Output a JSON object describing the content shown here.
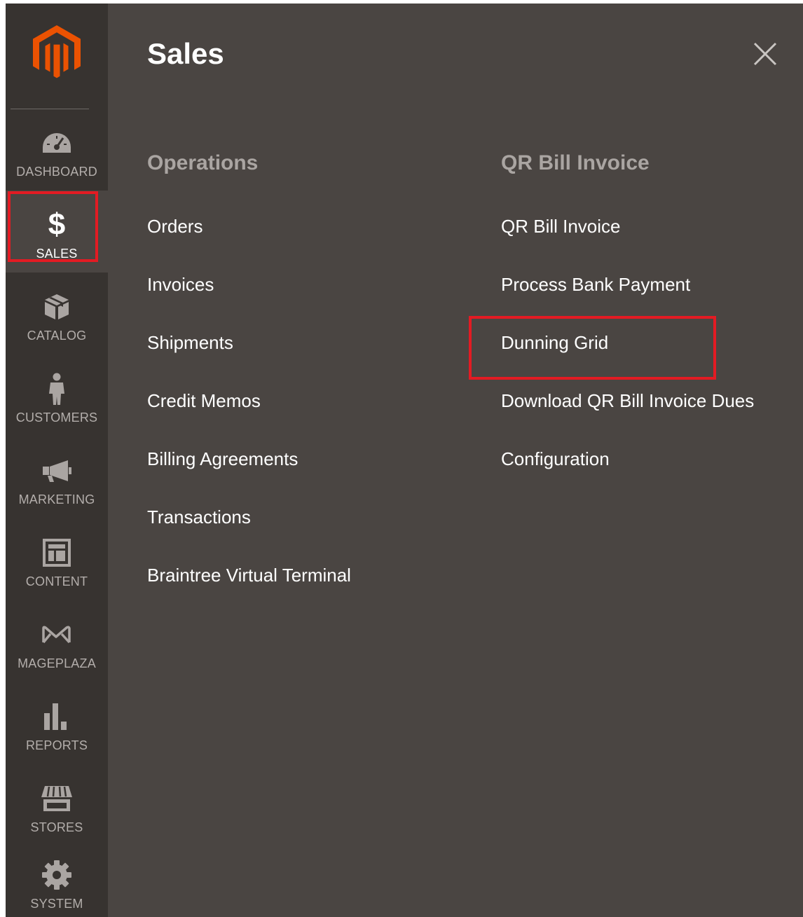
{
  "panel": {
    "title": "Sales"
  },
  "sidebar": {
    "items": [
      {
        "label": "DASHBOARD",
        "icon": "dashboard-icon"
      },
      {
        "label": "SALES",
        "icon": "dollar-icon"
      },
      {
        "label": "CATALOG",
        "icon": "cube-icon"
      },
      {
        "label": "CUSTOMERS",
        "icon": "person-icon"
      },
      {
        "label": "MARKETING",
        "icon": "megaphone-icon"
      },
      {
        "label": "CONTENT",
        "icon": "layout-icon"
      },
      {
        "label": "MAGEPLAZA",
        "icon": "mageplaza-icon"
      },
      {
        "label": "REPORTS",
        "icon": "bar-chart-icon"
      },
      {
        "label": "STORES",
        "icon": "storefront-icon"
      },
      {
        "label": "SYSTEM",
        "icon": "gear-icon"
      }
    ]
  },
  "operations": {
    "header": "Operations",
    "items": [
      "Orders",
      "Invoices",
      "Shipments",
      "Credit Memos",
      "Billing Agreements",
      "Transactions",
      "Braintree Virtual Terminal"
    ]
  },
  "qr_bill": {
    "header": "QR Bill Invoice",
    "items": [
      "QR Bill Invoice",
      "Process Bank Payment",
      "Dunning Grid",
      "Download QR Bill Invoice Dues",
      "Configuration"
    ]
  },
  "colors": {
    "sidebar_bg": "#373330",
    "panel_bg": "#4a4542",
    "logo": "#eb5202",
    "highlight": "#e31b23",
    "header_text": "#aaa5a2",
    "nav_label": "#b3aeab"
  }
}
